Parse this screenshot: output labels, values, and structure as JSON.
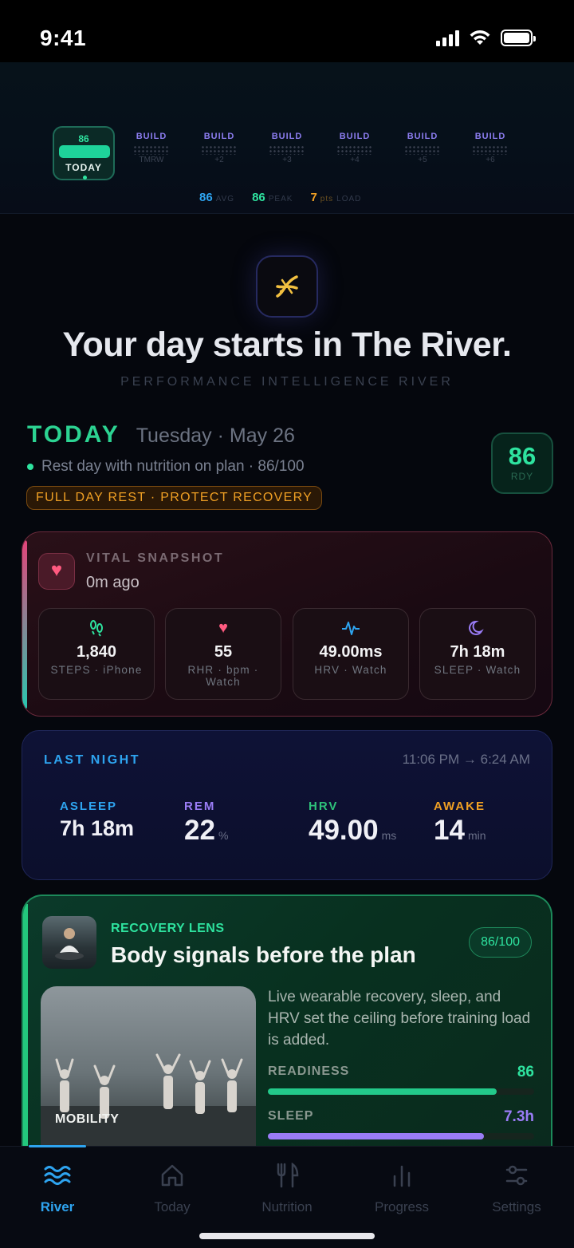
{
  "status_bar": {
    "time": "9:41"
  },
  "week_strip": {
    "today": {
      "score": "86",
      "label": "TODAY"
    },
    "days": [
      {
        "tag": "BUILD",
        "sub": "TMRW"
      },
      {
        "tag": "BUILD",
        "sub": "+2"
      },
      {
        "tag": "BUILD",
        "sub": "+3"
      },
      {
        "tag": "BUILD",
        "sub": "+4"
      },
      {
        "tag": "BUILD",
        "sub": "+5"
      },
      {
        "tag": "BUILD",
        "sub": "+6"
      }
    ],
    "stats": [
      {
        "value": "86",
        "unit": "AVG",
        "color": "#2ea4f0"
      },
      {
        "value": "86",
        "unit": "PEAK",
        "color": "#2ee39f"
      },
      {
        "value": "7",
        "unit_small": "pts",
        "unit": "LOAD",
        "color": "#f0a024"
      }
    ]
  },
  "hero": {
    "title": "Your day starts in The River.",
    "subtitle": "PERFORMANCE INTELLIGENCE RIVER",
    "icon": "dna-icon"
  },
  "today": {
    "label": "TODAY",
    "date": "Tuesday · May 26",
    "summary": "Rest day with nutrition on plan · 86/100",
    "pill": "FULL DAY REST · PROTECT RECOVERY",
    "ready_score": "86",
    "ready_label": "RDY"
  },
  "vital": {
    "label": "VITAL SNAPSHOT",
    "ago": "0m ago",
    "tiles": [
      {
        "icon": "footsteps-icon",
        "value": "1,840",
        "source": "STEPS · iPhone",
        "color": "#2ee39f"
      },
      {
        "icon": "heart-icon",
        "value": "55",
        "source": "RHR · bpm · Watch",
        "color": "#ff5a80"
      },
      {
        "icon": "pulse-icon",
        "value": "49.00ms",
        "source": "HRV · Watch",
        "color": "#2ea4f0"
      },
      {
        "icon": "moon-icon",
        "value": "7h 18m",
        "source": "SLEEP · Watch",
        "color": "#9a7cf6"
      }
    ]
  },
  "last_night": {
    "label": "LAST NIGHT",
    "time_range": "11:06 PM → 6:24 AM",
    "metrics": [
      {
        "key": "ASLEEP",
        "value": "7h 18m",
        "unit": "",
        "color": "#2ea4f0"
      },
      {
        "key": "REM",
        "value": "22",
        "unit": "%",
        "color": "#9a7cf6"
      },
      {
        "key": "HRV",
        "value": "49.00",
        "unit": "ms",
        "color": "#2ec27a"
      },
      {
        "key": "AWAKE",
        "value": "14",
        "unit": "min",
        "color": "#f0a024"
      }
    ]
  },
  "recovery": {
    "category": "RECOVERY LENS",
    "title": "Body signals before the plan",
    "score": "86/100",
    "photo_caption": "MOBILITY",
    "description": "Live wearable recovery, sleep, and HRV set the ceiling before training load is added.",
    "rows": [
      {
        "label": "READINESS",
        "value": "86",
        "fraction": 0.86,
        "color": "#23c98a"
      },
      {
        "label": "SLEEP",
        "value": "7.3h",
        "fraction": 0.81,
        "color": "#9a7cf6"
      }
    ]
  },
  "tabs": [
    {
      "label": "River",
      "icon": "waves-icon",
      "active": true
    },
    {
      "label": "Today",
      "icon": "home-icon",
      "active": false
    },
    {
      "label": "Nutrition",
      "icon": "fork-knife-icon",
      "active": false
    },
    {
      "label": "Progress",
      "icon": "bar-chart-icon",
      "active": false
    },
    {
      "label": "Settings",
      "icon": "sliders-icon",
      "active": false
    }
  ]
}
